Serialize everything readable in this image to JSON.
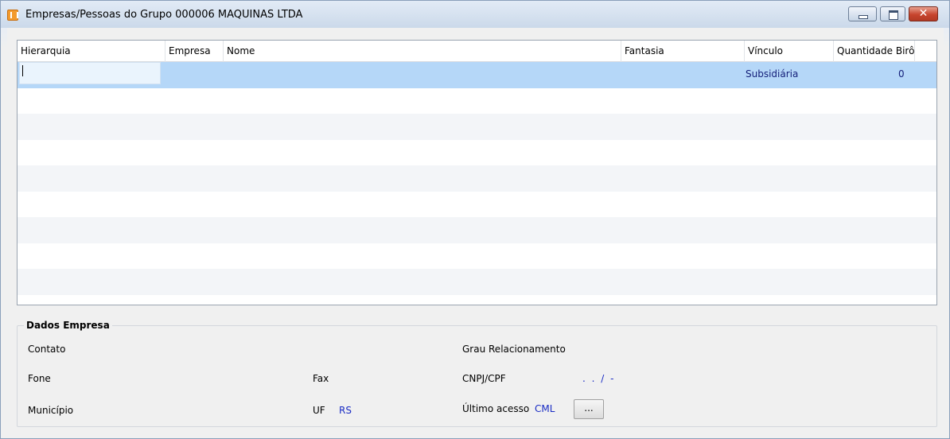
{
  "window": {
    "title": "Empresas/Pessoas do Grupo 000006 MAQUINAS LTDA",
    "close_glyph": "✕"
  },
  "grid": {
    "columns": [
      "Hierarquia",
      "Empresa",
      "Nome",
      "Fantasia",
      "Vínculo",
      "Quantidade Birô"
    ],
    "rows": [
      {
        "hierarquia": "",
        "empresa": "",
        "nome": "",
        "fantasia": "",
        "vinculo": "Subsidiária",
        "quantidade_biro": "0"
      }
    ]
  },
  "dados_empresa": {
    "title": "Dados Empresa",
    "contato_label": "Contato",
    "grau_label": "Grau Relacionamento",
    "fone_label": "Fone",
    "fax_label": "Fax",
    "cnpj_label": "CNPJ/CPF",
    "cnpj_value": ". . / -",
    "municipio_label": "Município",
    "uf_label": "UF",
    "uf_value": "RS",
    "ultimo_acesso_label": "Último acesso",
    "ultimo_acesso_value": "CML",
    "browse_button": "..."
  },
  "colors": {
    "selected_row": "#b5d7f8",
    "value_text": "#1a2cc4"
  }
}
